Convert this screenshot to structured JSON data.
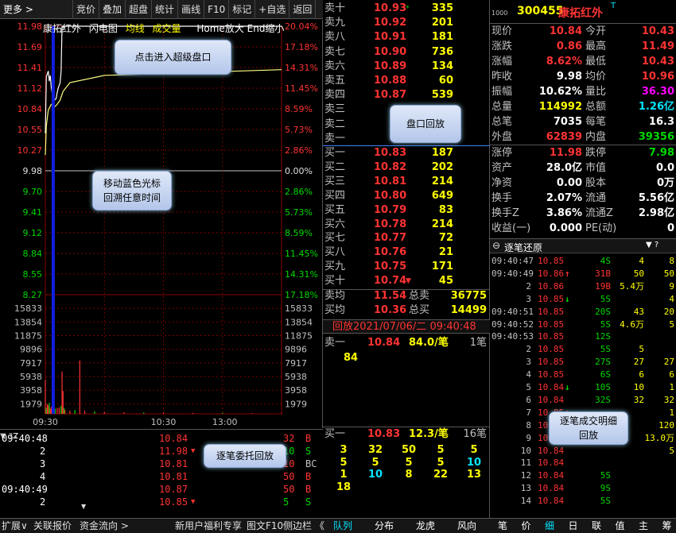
{
  "toolbar": [
    "更多 >",
    "竞价",
    "叠加",
    "超盘",
    "统计",
    "画线",
    "F10",
    "标记",
    "+自选",
    "返回"
  ],
  "chart_head": {
    "name": "康拓红外",
    "t1": "闪电图",
    "t2": "均线",
    "t3": "成交量",
    "hint": "Home放大 End缩小"
  },
  "callouts": {
    "super": "点击进入超级盘口",
    "cursor1": "移动蓝色光标",
    "cursor2": "回溯任意时间",
    "book": "盘口回放",
    "tick": "逐笔委托回放",
    "zb1": "逐笔成交明细",
    "zb2": "回放"
  },
  "chart_data": {
    "type": "line",
    "price_ticks": [
      "11.98",
      "11.69",
      "11.41",
      "11.12",
      "10.84",
      "10.55",
      "10.27",
      "9.98",
      "9.70",
      "9.41",
      "9.12",
      "8.84",
      "8.55",
      "8.27"
    ],
    "pct_ticks": [
      "20.04%",
      "17.18%",
      "14.31%",
      "11.45%",
      "8.59%",
      "5.73%",
      "2.86%",
      "0.00%",
      "2.86%",
      "5.73%",
      "8.59%",
      "11.45%",
      "14.31%",
      "17.18%"
    ],
    "vol_ticks": [
      "15833",
      "13854",
      "11875",
      "9896",
      "7917",
      "5938",
      "3958",
      "1979"
    ],
    "time_ticks": [
      "09:30",
      "10:30",
      "13:00"
    ],
    "prev_close": 9.98,
    "ylim": [
      8.27,
      11.98
    ],
    "price": [
      [
        0,
        10.5
      ],
      [
        1,
        11.28
      ],
      [
        2,
        11.32
      ],
      [
        3,
        11.36
      ],
      [
        4,
        11.22
      ],
      [
        5,
        11.3
      ],
      [
        6,
        11.14
      ],
      [
        7,
        11.05
      ],
      [
        8,
        10.98
      ],
      [
        9,
        10.95
      ],
      [
        10,
        10.97
      ],
      [
        11,
        10.98
      ],
      [
        12,
        11.06
      ],
      [
        13,
        11.12
      ],
      [
        14,
        11.16
      ],
      [
        15,
        11.2
      ],
      [
        16,
        11.35
      ],
      [
        17,
        11.98
      ],
      [
        18,
        11.98
      ],
      [
        240,
        11.98
      ]
    ],
    "avg": [
      [
        0,
        10.2
      ],
      [
        1,
        10.6
      ],
      [
        3,
        10.82
      ],
      [
        6,
        10.9
      ],
      [
        9,
        10.86
      ],
      [
        12,
        10.9
      ],
      [
        15,
        10.96
      ],
      [
        18,
        11.08
      ],
      [
        25,
        11.2
      ],
      [
        60,
        11.3
      ],
      [
        240,
        11.38
      ]
    ],
    "volume": [
      [
        0,
        5200
      ],
      [
        1,
        900
      ],
      [
        2,
        1500
      ],
      [
        3,
        1300
      ],
      [
        4,
        1700
      ],
      [
        5,
        800
      ],
      [
        6,
        1100
      ],
      [
        7,
        1400
      ],
      [
        8,
        700
      ],
      [
        9,
        600
      ],
      [
        10,
        800
      ],
      [
        12,
        900
      ],
      [
        14,
        1000
      ],
      [
        16,
        1200
      ],
      [
        17,
        6500
      ],
      [
        18,
        3500
      ],
      [
        19,
        900
      ],
      [
        20,
        600
      ],
      [
        25,
        500
      ],
      [
        30,
        600
      ],
      [
        35,
        8200
      ],
      [
        40,
        500
      ],
      [
        50,
        400
      ],
      [
        60,
        300
      ],
      [
        80,
        250
      ],
      [
        100,
        200
      ],
      [
        120,
        200
      ],
      [
        150,
        150
      ],
      [
        180,
        150
      ],
      [
        210,
        100
      ],
      [
        240,
        100
      ]
    ],
    "cursor_index": 8
  },
  "tick": {
    "rows": [
      {
        "t": "09:40:48",
        "n": "",
        "p": "10.84",
        "pc": "red",
        "a": "",
        "v": "32",
        "vc": "red",
        "s": "B",
        "sc": "red"
      },
      {
        "t": "",
        "n": "2",
        "p": "11.98",
        "pc": "red",
        "a": "▼",
        "v": "10",
        "vc": "green",
        "s": "S",
        "sc": "green"
      },
      {
        "t": "",
        "n": "3",
        "p": "10.81",
        "pc": "red",
        "a": "",
        "v": "10",
        "vc": "red",
        "s": "BC",
        "sc": "gry"
      },
      {
        "t": "",
        "n": "4",
        "p": "10.81",
        "pc": "red",
        "a": "",
        "v": "50",
        "vc": "red",
        "s": "B",
        "sc": "red"
      },
      {
        "t": "09:40:49",
        "n": "",
        "p": "10.87",
        "pc": "red",
        "a": "",
        "v": "50",
        "vc": "red",
        "s": "B",
        "sc": "red"
      },
      {
        "t": "",
        "n": "2",
        "p": "10.85",
        "pc": "red",
        "a": "▼",
        "v": "5",
        "vc": "green",
        "s": "S",
        "sc": "green"
      }
    ],
    "icons": "▼ ?",
    "z": "Z"
  },
  "orderbook": {
    "asks": [
      {
        "l": "卖十",
        "p": "10.93",
        "v": "335",
        "m": "*"
      },
      {
        "l": "卖九",
        "p": "10.92",
        "v": "201",
        "m": ""
      },
      {
        "l": "卖八",
        "p": "10.91",
        "v": "181",
        "m": ""
      },
      {
        "l": "卖七",
        "p": "10.90",
        "v": "736",
        "m": ""
      },
      {
        "l": "卖六",
        "p": "10.89",
        "v": "134",
        "m": ""
      },
      {
        "l": "卖五",
        "p": "10.88",
        "v": "60",
        "m": ""
      },
      {
        "l": "卖四",
        "p": "10.87",
        "v": "539",
        "m": ""
      },
      {
        "l": "卖三",
        "p": "",
        "v": "",
        "m": ""
      },
      {
        "l": "卖二",
        "p": "",
        "v": "",
        "m": ""
      },
      {
        "l": "卖一",
        "p": "",
        "v": "",
        "m": ""
      }
    ],
    "bids": [
      {
        "l": "买一",
        "p": "10.83",
        "v": "187",
        "m": ""
      },
      {
        "l": "买二",
        "p": "10.82",
        "v": "202",
        "m": ""
      },
      {
        "l": "买三",
        "p": "10.81",
        "v": "214",
        "m": ""
      },
      {
        "l": "买四",
        "p": "10.80",
        "v": "649",
        "m": ""
      },
      {
        "l": "买五",
        "p": "10.79",
        "v": "83",
        "m": ""
      },
      {
        "l": "买六",
        "p": "10.78",
        "v": "214",
        "m": ""
      },
      {
        "l": "买七",
        "p": "10.77",
        "v": "72",
        "m": ""
      },
      {
        "l": "买八",
        "p": "10.76",
        "v": "21",
        "m": ""
      },
      {
        "l": "买九",
        "p": "10.75",
        "v": "171",
        "m": ""
      },
      {
        "l": "买十",
        "p": "10.74",
        "v": "45",
        "m": "▼"
      }
    ],
    "avg_ask_l": "卖均",
    "avg_ask_p": "11.54",
    "tot_ask_l": "总卖",
    "tot_ask_v": "36775",
    "avg_bid_l": "买均",
    "avg_bid_p": "10.36",
    "tot_bid_l": "总买",
    "tot_bid_v": "14499",
    "replay": "回放2021/07/06/二 09:40:48",
    "ask1_l": "卖一",
    "ask1_p": "10.84",
    "ask1_v": "84.0/笔",
    "ask1_n": "1笔",
    "ask1_q": "84",
    "bid1_l": "买一",
    "bid1_p": "10.83",
    "bid1_v": "12.3/笔",
    "bid1_n": "16笔",
    "bid1_q": [
      [
        "3",
        "32",
        "50",
        "5",
        "5"
      ],
      [
        "5",
        "5",
        "5",
        "5",
        "10"
      ],
      [
        "1",
        "10",
        "8",
        "22",
        "13"
      ],
      [
        "18",
        "",
        "",
        "",
        ""
      ]
    ]
  },
  "quote": {
    "code": "300455",
    "name": "康拓红外",
    "tag": "T",
    "pre": "1000",
    "rows": [
      [
        "现价",
        "10.84",
        "red",
        "今开",
        "10.43",
        "red"
      ],
      [
        "涨跌",
        "0.86",
        "red",
        "最高",
        "11.49",
        "red"
      ],
      [
        "涨幅",
        "8.62%",
        "red",
        "最低",
        "10.43",
        "red"
      ],
      [
        "昨收",
        "9.98",
        "wht",
        "均价",
        "10.96",
        "red"
      ],
      [
        "振幅",
        "10.62%",
        "wht",
        "量比",
        "36.30",
        "mag"
      ],
      [
        "总量",
        "114992",
        "yel",
        "总额",
        "1.26亿",
        "cyan"
      ],
      [
        "总笔",
        "7035",
        "wht",
        "每笔",
        "16.3",
        "wht"
      ],
      [
        "外盘",
        "62839",
        "red",
        "内盘",
        "39356",
        "green"
      ],
      [
        "涨停",
        "11.98",
        "red",
        "跌停",
        "7.98",
        "green"
      ],
      [
        "资产",
        "28.0亿",
        "wht",
        "市值",
        "0.0",
        "wht"
      ],
      [
        "净资",
        "0.00",
        "wht",
        "股本",
        "0万",
        "wht"
      ],
      [
        "换手",
        "2.07%",
        "wht",
        "流通",
        "5.56亿",
        "wht"
      ],
      [
        "换手Z",
        "3.86%",
        "wht",
        "流通Z",
        "2.98亿",
        "wht"
      ],
      [
        "收益(一)",
        "0.000",
        "wht",
        "PE(动)",
        "0",
        "wht"
      ]
    ]
  },
  "zhubi": {
    "title": "逐笔还原",
    "icons": "▼ ?",
    "rows": [
      [
        "09:40:47",
        "",
        "10.85",
        "",
        "4S",
        "g",
        "4",
        "8"
      ],
      [
        "09:40:49",
        "",
        "10.86",
        "↑",
        "31B",
        "r",
        "50",
        "50"
      ],
      [
        "",
        "2",
        "10.86",
        "",
        "19B",
        "r",
        "5.4万",
        "9"
      ],
      [
        "",
        "3",
        "10.85",
        "↓",
        "5S",
        "g",
        "",
        "4"
      ],
      [
        "09:40:51",
        "",
        "10.85",
        "",
        "20S",
        "g",
        "43",
        "20"
      ],
      [
        "09:40:52",
        "",
        "10.85",
        "",
        "5S",
        "g",
        "4.6万",
        "5"
      ],
      [
        "09:40:53",
        "",
        "10.85",
        "",
        "12S",
        "g",
        "",
        ""
      ],
      [
        "",
        "2",
        "10.85",
        "",
        "5S",
        "g",
        "5",
        ""
      ],
      [
        "",
        "3",
        "10.85",
        "",
        "27S",
        "g",
        "27",
        "27"
      ],
      [
        "",
        "4",
        "10.85",
        "",
        "6S",
        "g",
        "6",
        "6"
      ],
      [
        "",
        "5",
        "10.84",
        "↓",
        "10S",
        "g",
        "10",
        "1"
      ],
      [
        "",
        "6",
        "10.84",
        "",
        "32S",
        "g",
        "32",
        "32"
      ],
      [
        "",
        "7",
        "10.85",
        "↑",
        "",
        "",
        "",
        "1"
      ],
      [
        "",
        "8",
        "10.85",
        "",
        "",
        "",
        "",
        "120"
      ],
      [
        "",
        "9",
        "10.85",
        "",
        "",
        "",
        "",
        "13.0万"
      ],
      [
        "",
        "10",
        "10.84",
        "",
        "",
        "",
        "",
        "5"
      ],
      [
        "",
        "11",
        "10.84",
        "",
        "",
        "",
        "",
        ""
      ],
      [
        "",
        "12",
        "10.84",
        "",
        "5S",
        "g",
        "",
        ""
      ],
      [
        "",
        "13",
        "10.84",
        "",
        "9S",
        "g",
        "",
        ""
      ],
      [
        "",
        "14",
        "10.84",
        "",
        "5S",
        "g",
        "",
        ""
      ]
    ]
  },
  "bottom": {
    "left": [
      "扩展∨",
      "关联报价",
      "资金流向 >",
      "新用户福利专享",
      "图文F10",
      "侧边栏 《"
    ],
    "mid": [
      "队列",
      "分布",
      "龙虎",
      "风向"
    ],
    "right": [
      "笔",
      "价",
      "细",
      "日",
      "联",
      "值",
      "主",
      "筹"
    ]
  },
  "colors": {
    "up": "#ff3333",
    "down": "#00d800",
    "cursor": "#1020e0",
    "avg": "#ffff80"
  }
}
